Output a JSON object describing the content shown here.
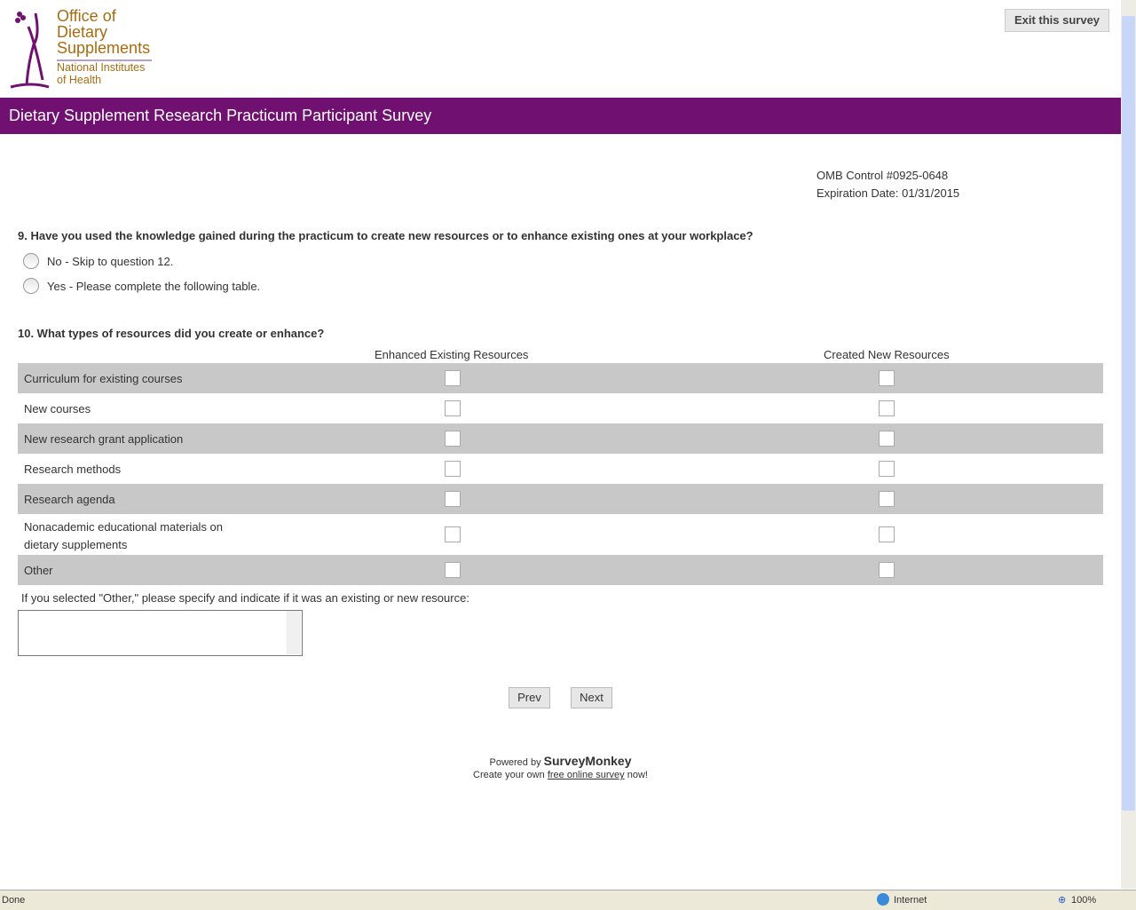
{
  "logo": {
    "line1": "Office of",
    "line2": "Dietary",
    "line3": "Supplements",
    "line4": "National Institutes",
    "line5": "of Health"
  },
  "exit_label": "Exit this survey",
  "banner_title": "Dietary Supplement Research Practicum Participant Survey",
  "omb": {
    "control": "OMB Control #0925-0648",
    "expiration": "Expiration Date: 01/31/2015"
  },
  "q9": {
    "text": "9. Have you used the knowledge gained during the practicum to create new resources or to enhance existing ones at your workplace?",
    "options": [
      "No - Skip to question 12.",
      "Yes - Please complete the following table."
    ]
  },
  "q10": {
    "text": "10. What types of resources did you create or enhance?",
    "col1": "Enhanced Existing Resources",
    "col2": "Created New Resources",
    "rows": [
      "Curriculum for existing courses",
      "New courses",
      "New research grant application",
      "Research methods",
      "Research agenda",
      "Nonacademic educational materials on dietary supplements",
      "Other"
    ],
    "other_prompt": "If you selected \"Other,\" please specify and indicate if it was an existing or new resource:"
  },
  "nav": {
    "prev": "Prev",
    "next": "Next"
  },
  "footer": {
    "powered": "Powered by",
    "brand": "SurveyMonkey",
    "create_pre": "Create your own",
    "link": "free online survey",
    "create_post": "now!"
  },
  "status": {
    "text": "Done",
    "zone": "Internet",
    "zoom": "100%"
  }
}
